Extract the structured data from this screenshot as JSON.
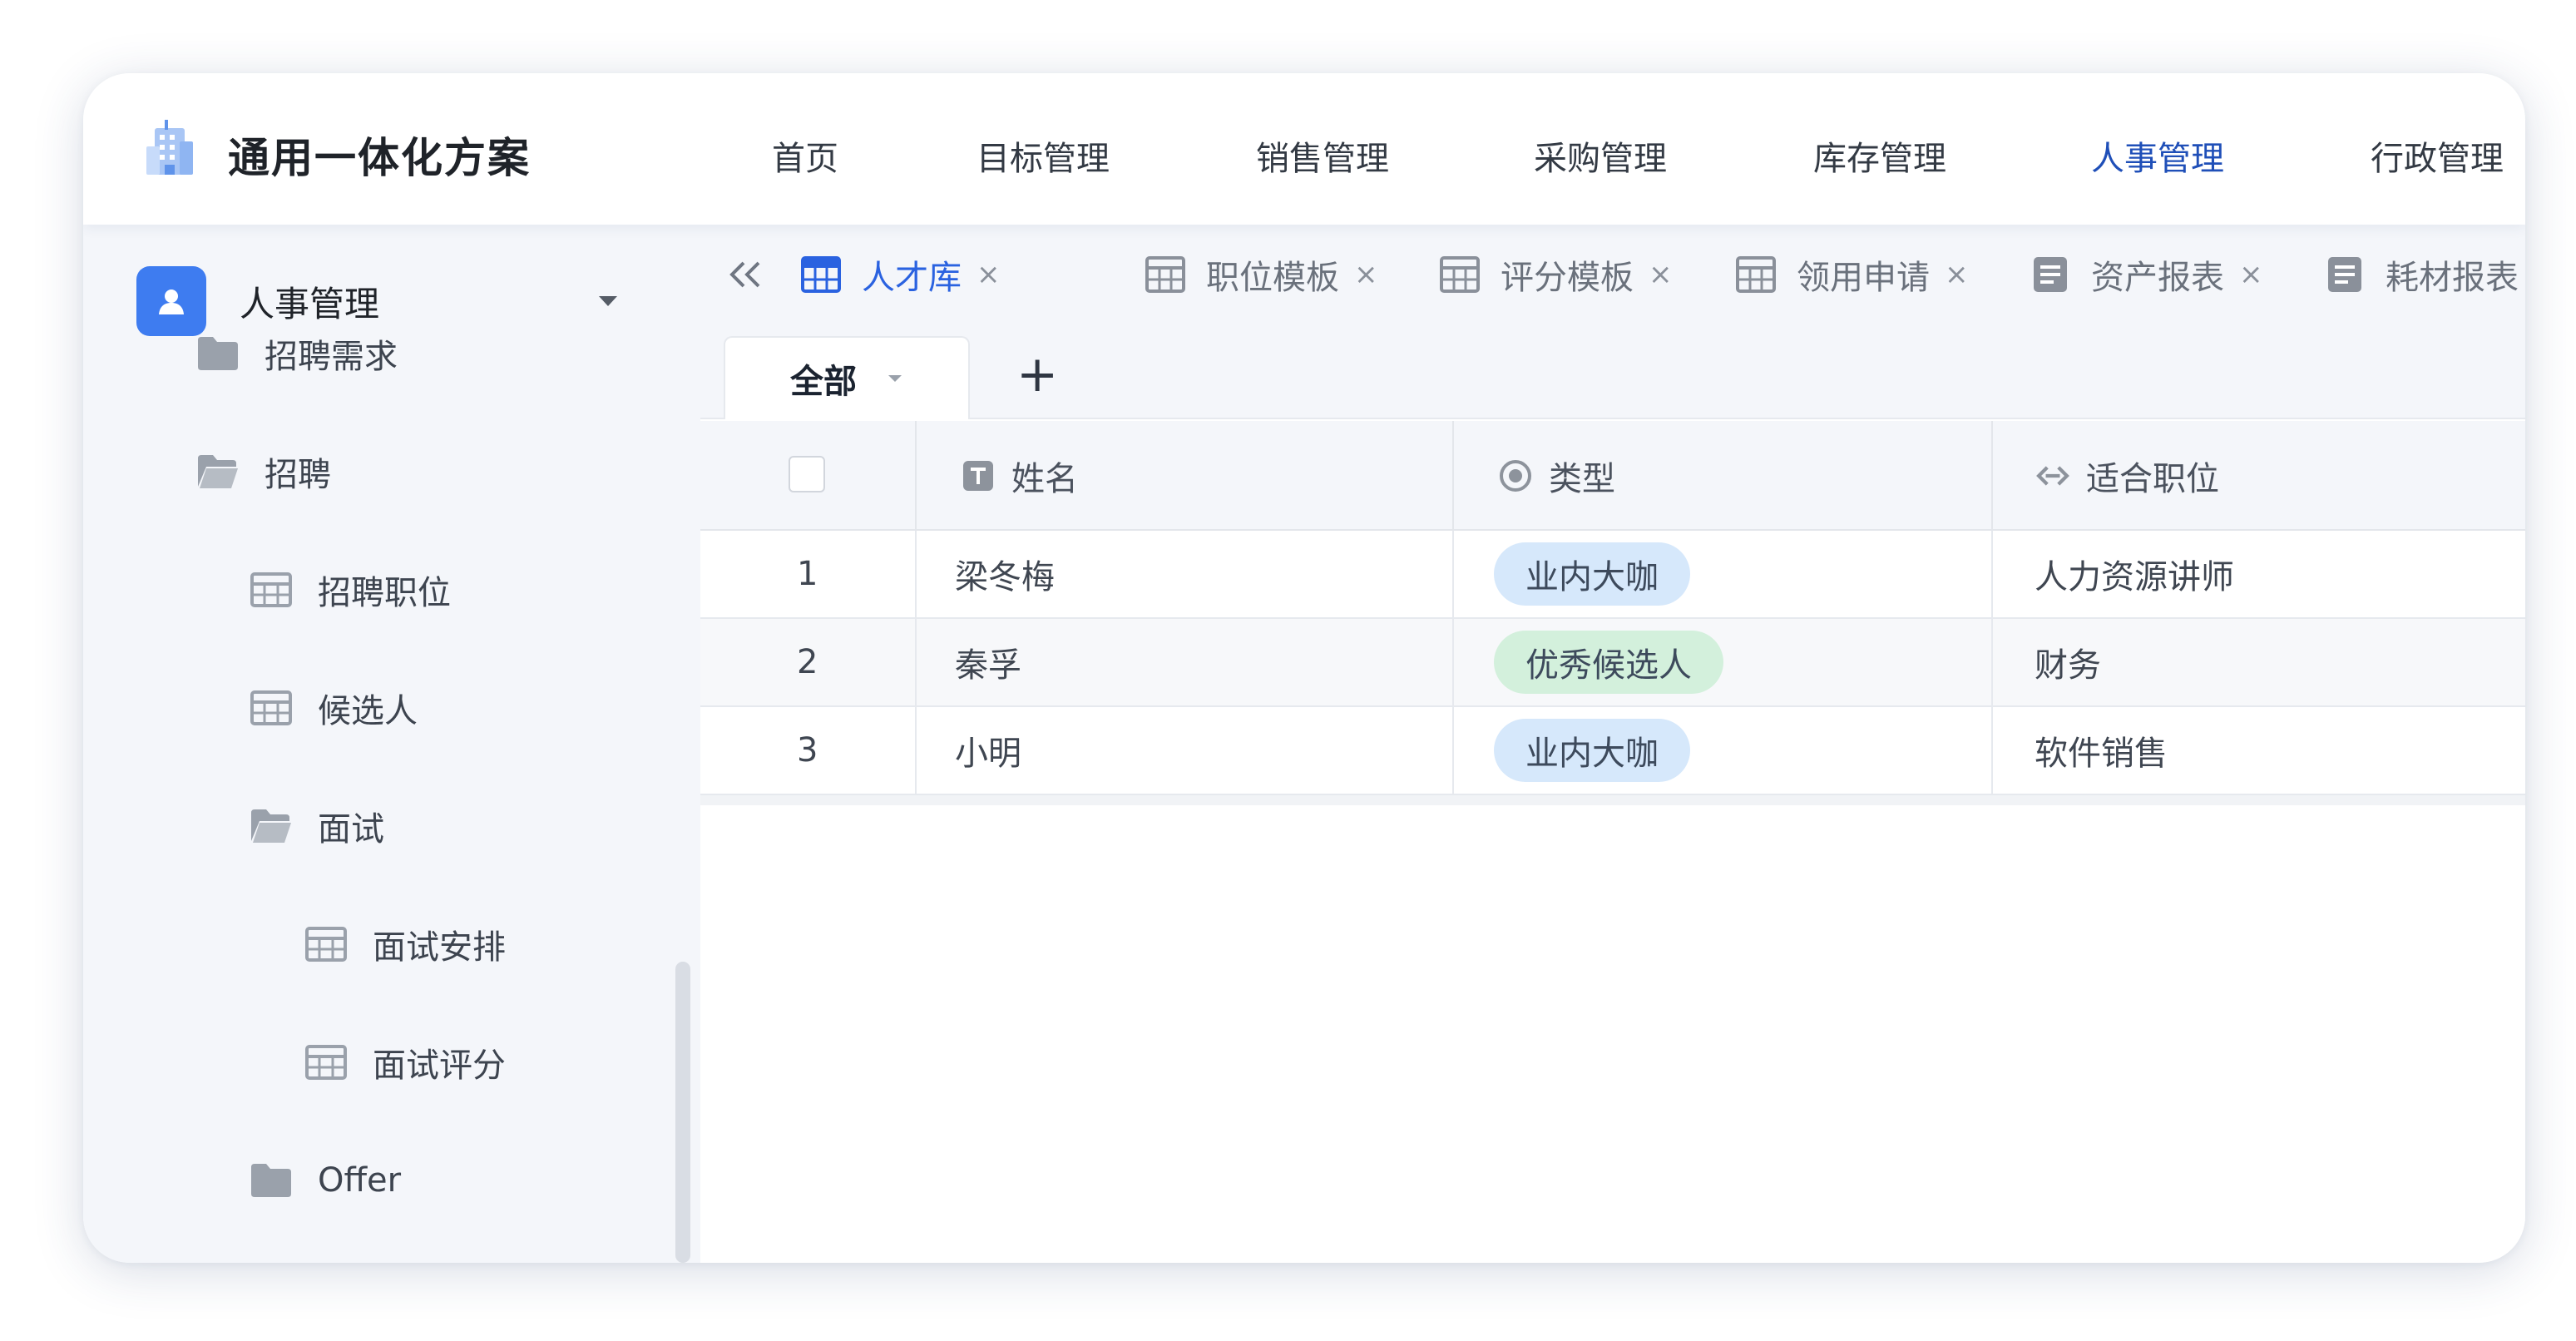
{
  "app": {
    "title": "通用一体化方案",
    "logo_icon": "building-icon"
  },
  "nav": {
    "items": [
      {
        "label": "首页"
      },
      {
        "label": "目标管理"
      },
      {
        "label": "销售管理"
      },
      {
        "label": "采购管理"
      },
      {
        "label": "库存管理"
      },
      {
        "label": "人事管理",
        "active": true
      },
      {
        "label": "行政管理"
      }
    ],
    "active_color": "#1f4fb8"
  },
  "sidebar": {
    "root": {
      "label": "人事管理",
      "icon": "person-badge-icon",
      "expanded": true
    },
    "items": [
      {
        "label": "招聘需求",
        "icon": "folder-icon",
        "level": 1
      },
      {
        "label": "招聘",
        "icon": "folder-open-icon",
        "level": 1
      },
      {
        "label": "招聘职位",
        "icon": "table-icon",
        "level": 2
      },
      {
        "label": "候选人",
        "icon": "table-icon",
        "level": 2
      },
      {
        "label": "面试",
        "icon": "folder-open-icon",
        "level": 2
      },
      {
        "label": "面试安排",
        "icon": "table-icon",
        "level": 3
      },
      {
        "label": "面试评分",
        "icon": "table-icon",
        "level": 3
      },
      {
        "label": "Offer",
        "icon": "folder-icon",
        "level": 2
      }
    ]
  },
  "tabs": {
    "items": [
      {
        "label": "人才库",
        "icon": "table-icon",
        "active": true
      },
      {
        "label": "职位模板",
        "icon": "table-icon"
      },
      {
        "label": "评分模板",
        "icon": "table-icon"
      },
      {
        "label": "领用申请",
        "icon": "table-icon"
      },
      {
        "label": "资产报表",
        "icon": "report-icon"
      },
      {
        "label": "耗材报表",
        "icon": "report-icon"
      }
    ],
    "close_glyph": "×",
    "accent": "#2a62e0"
  },
  "views": {
    "active_label": "全部",
    "add_glyph": "+"
  },
  "table": {
    "columns": [
      {
        "label": "姓名",
        "icon": "text-field-icon"
      },
      {
        "label": "类型",
        "icon": "single-select-icon"
      },
      {
        "label": "适合职位",
        "icon": "link-field-icon"
      }
    ],
    "rows": [
      {
        "index": "1",
        "name": "梁冬梅",
        "type": "业内大咖",
        "type_color": "#d6e8fb",
        "position": "人力资源讲师"
      },
      {
        "index": "2",
        "name": "秦孚",
        "type": "优秀候选人",
        "type_color": "#d3f0dc",
        "position": "财务"
      },
      {
        "index": "3",
        "name": "小明",
        "type": "业内大咖",
        "type_color": "#d6e8fb",
        "position": "软件销售"
      }
    ]
  }
}
